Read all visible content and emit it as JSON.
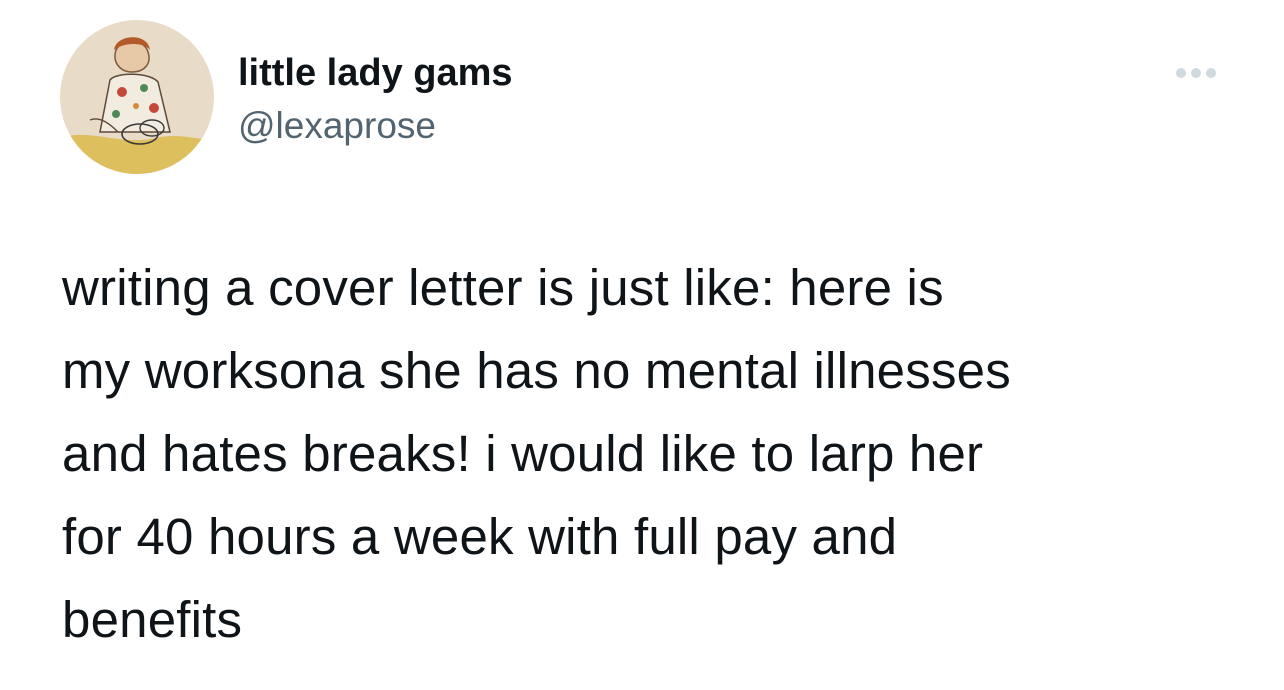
{
  "author": {
    "display_name": "little lady gams",
    "handle": "@lexaprose",
    "avatar_icon": "profile-avatar-drawing"
  },
  "menu": {
    "icon": "more-options-icon"
  },
  "tweet": {
    "lines": [
      "writing a cover letter is just like: here is",
      "my worksona she has no mental illnesses",
      "and hates breaks! i would like to larp her",
      "for 40 hours a week with full pay and",
      "benefits"
    ]
  },
  "colors": {
    "text": "#0f1419",
    "secondary_text": "#536471",
    "more_icon": "#cfd9de"
  }
}
